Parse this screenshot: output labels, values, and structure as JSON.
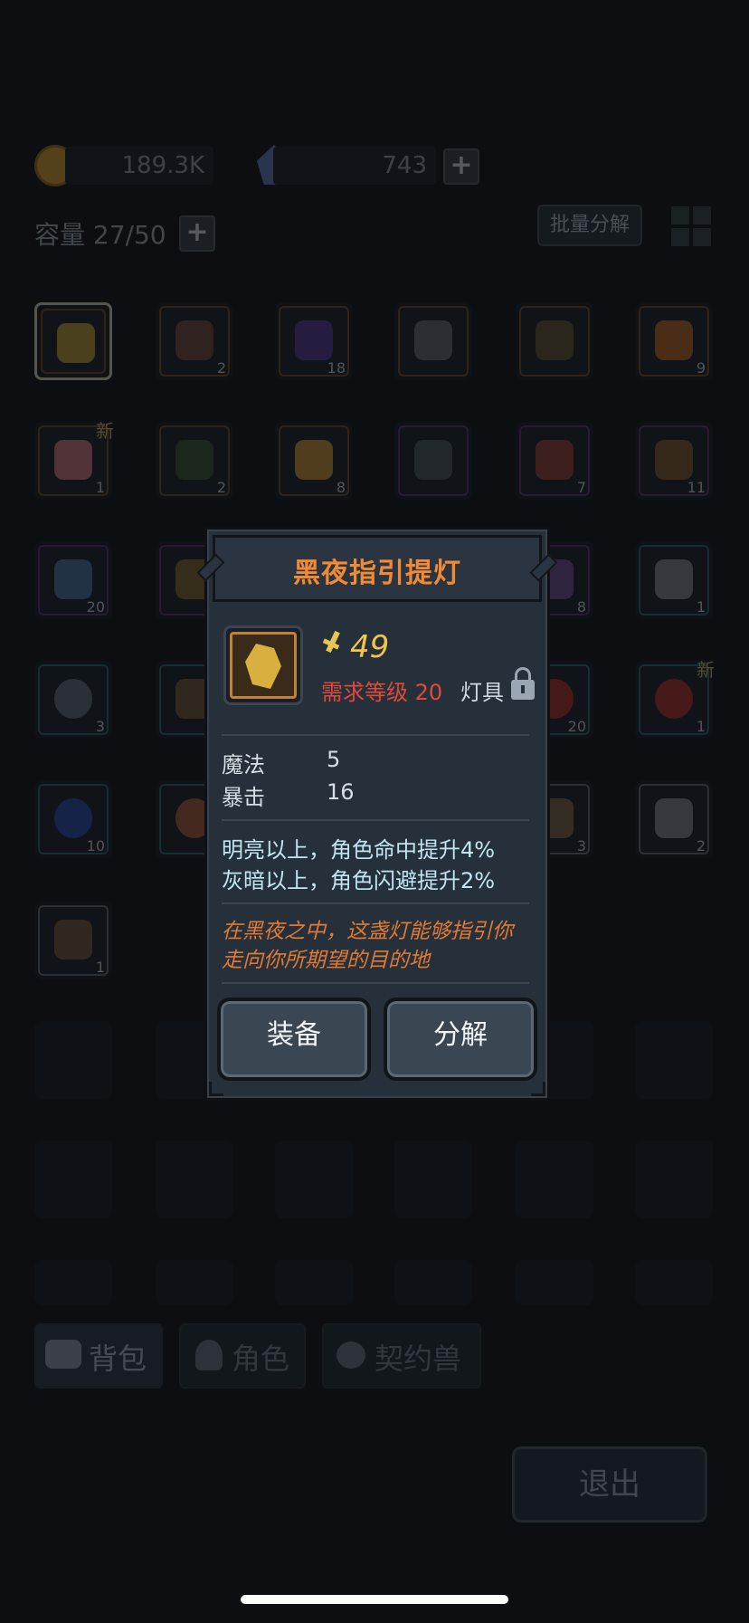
{
  "resources": {
    "gold": "189.3K",
    "crystal": "743"
  },
  "inventory": {
    "capacity_label": "容量 27/50",
    "batch_decompose_label": "批量分解",
    "new_badge": "新",
    "row1_counts": [
      "",
      "2",
      "18",
      "",
      "",
      "9"
    ],
    "row2_counts": [
      "1",
      "2",
      "8",
      "",
      "7",
      "11"
    ],
    "row3_counts": [
      "20",
      "",
      "",
      "",
      "8",
      "1"
    ],
    "row4_counts": [
      "3",
      "",
      "",
      "",
      "20",
      "1"
    ],
    "row5_counts": [
      "10",
      "",
      "",
      "",
      "3",
      "2"
    ],
    "row6_counts": [
      "1"
    ]
  },
  "tabs": {
    "backpack": "背包",
    "character": "角色",
    "pet": "契约兽"
  },
  "exit_label": "退出",
  "item_modal": {
    "title": "黑夜指引提灯",
    "power": "49",
    "required_level": "需求等级 20",
    "item_type": "灯具",
    "stats": [
      {
        "name": "魔法",
        "value": "5"
      },
      {
        "name": "暴击",
        "value": "16"
      }
    ],
    "bonus_lines": [
      "明亮以上，角色命中提升4%",
      "灰暗以上，角色闪避提升2%"
    ],
    "flavor_lines": [
      "在黑夜之中，这盏灯能够指引你",
      "走向你所期望的目的地"
    ],
    "equip_label": "装备",
    "decompose_label": "分解"
  },
  "colors": {
    "title_orange": "#f08a34",
    "required_red": "#e04a3a",
    "power_gold": "#f0c64a",
    "bonus_text": "#bfe6f2"
  },
  "icons": {
    "power": "sword-power-icon",
    "lock": "lock-icon"
  }
}
